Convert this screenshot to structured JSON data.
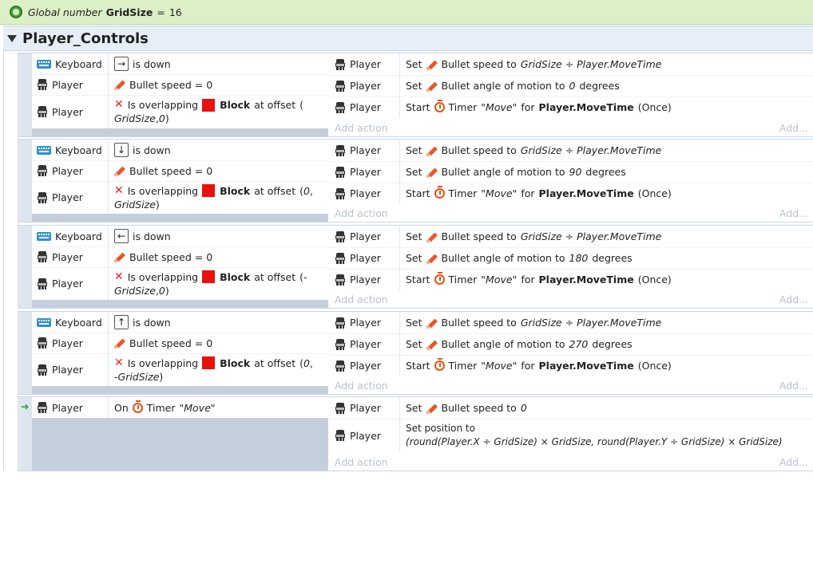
{
  "global": {
    "prefix": "Global number",
    "name": "GridSize",
    "equals": "=",
    "value": "16"
  },
  "group": {
    "name": "Player_Controls"
  },
  "common": {
    "keyboard": "Keyboard",
    "player": "Player",
    "is_down": "is down",
    "bullet_speed_zero": "Bullet speed = 0",
    "is_overlapping": "Is overlapping",
    "block": "Block",
    "at_offset": "at offset",
    "set": "Set",
    "start": "Start",
    "bullet_speed_to": "Bullet speed to",
    "speed_expr": "GridSize ÷ Player.MoveTime",
    "angle_of_motion_to": "Bullet angle of motion to",
    "degrees": "degrees",
    "timer": "Timer",
    "timer_name": "\"Move\"",
    "for": "for",
    "movetime": "Player.MoveTime",
    "once": "(Once)",
    "add_action": "Add action",
    "add_more": "Add..."
  },
  "events": [
    {
      "key": "→",
      "offset_a": "(GridSize, 0)",
      "offset_a_parts": [
        "(",
        "GridSize",
        ", ",
        "0",
        ")"
      ],
      "angle": "0"
    },
    {
      "key": "↓",
      "offset_a_parts": [
        "(",
        "0",
        ", ",
        "GridSize",
        ")"
      ],
      "angle": "90"
    },
    {
      "key": "←",
      "offset_a_parts": [
        "(-",
        "GridSize",
        ", ",
        "0",
        ")"
      ],
      "angle": "180"
    },
    {
      "key": "↑",
      "offset_a_parts": [
        "(",
        "0",
        ", ",
        "-GridSize",
        ")"
      ],
      "angle": "270"
    }
  ],
  "last_event": {
    "on": "On",
    "timer": "Timer",
    "timer_name": "\"Move\"",
    "set_speed_value": "0",
    "set_position": "Set position to",
    "pos_expr": "(round(Player.X ÷ GridSize) × GridSize, round(Player.Y ÷ GridSize) × GridSize)"
  },
  "icons": {
    "keyboard": "keyboard-icon",
    "sprite": "player-sprite-icon",
    "pen": "bullet-behavior-icon",
    "timer": "timer-icon",
    "overlap": "red-x-icon",
    "block": "red-block-icon",
    "global": "global-variable-icon"
  }
}
